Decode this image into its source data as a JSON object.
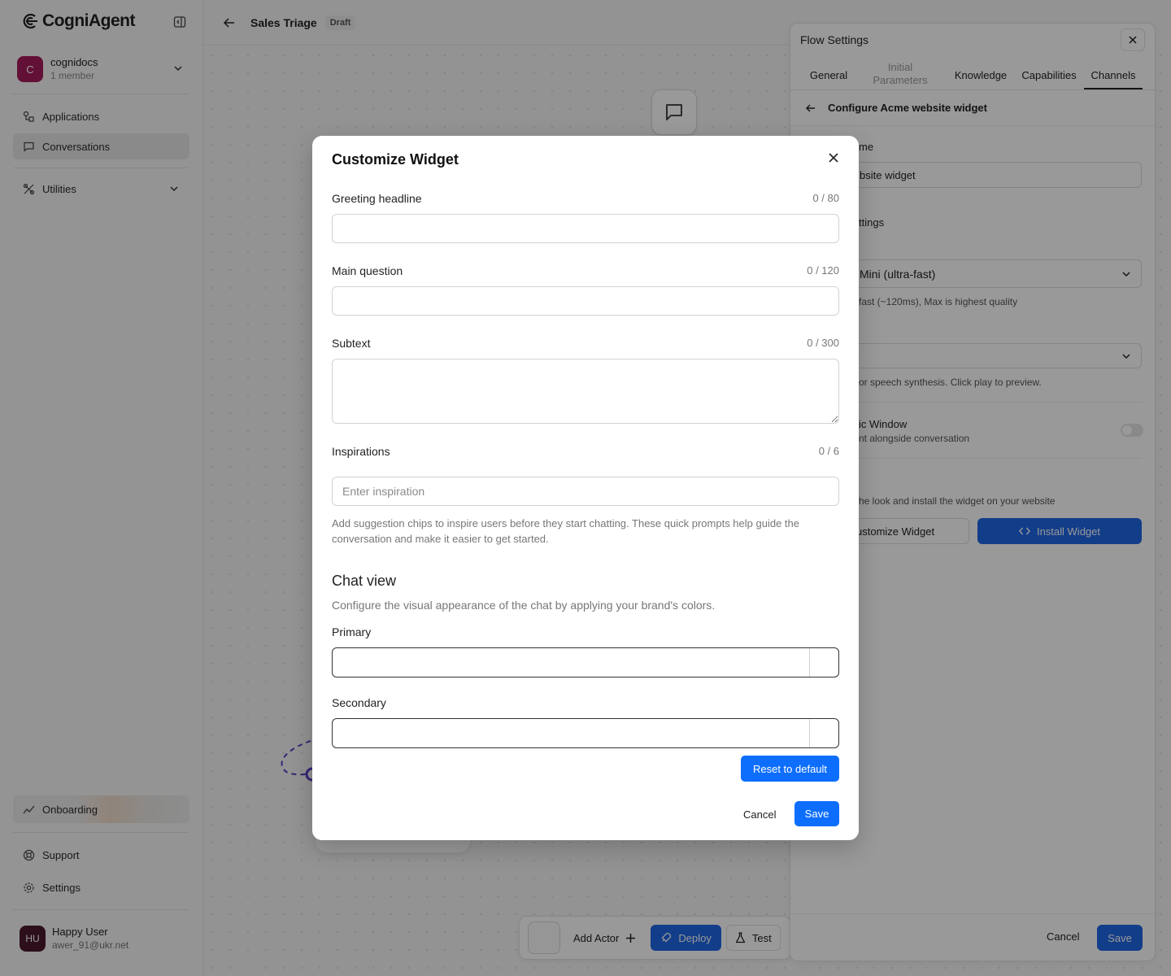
{
  "brand": {
    "name": "CogniAgent"
  },
  "workspace": {
    "initial": "C",
    "name": "cognidocs",
    "members": "1 member"
  },
  "nav": {
    "applications": "Applications",
    "conversations": "Conversations",
    "utilities": "Utilities",
    "onboarding": "Onboarding",
    "support": "Support",
    "settings": "Settings"
  },
  "user": {
    "initials": "HU",
    "name": "Happy User",
    "email": "awer_91@ukr.net"
  },
  "topbar": {
    "title": "Sales Triage",
    "status": "Draft"
  },
  "toolbar": {
    "add_actor": "Add Actor",
    "deploy": "Deploy",
    "test": "Test"
  },
  "flow_settings": {
    "title": "Flow Settings",
    "tabs": [
      "General",
      "Initial Parameters",
      "Knowledge",
      "Capabilities",
      "Channels"
    ],
    "active_tab": "Channels",
    "configure_title": "Configure Acme website widget",
    "name_label_partial": "me",
    "name_value_partial": "bsite widget",
    "settings_label_partial": "ttings",
    "model_value_partial": "Mini (ultra-fast)",
    "model_help_partial": "fast (~120ms), Max is highest quality",
    "voice_help_partial": "or speech synthesis. Click play to preview.",
    "artifact_title_partial": "ic Window",
    "artifact_help_partial": "nt alongside conversation",
    "install_help_partial": "he look and install the widget on your website",
    "customize_btn_partial": "ustomize Widget",
    "install_btn": "Install Widget",
    "cancel": "Cancel",
    "save": "Save"
  },
  "modal": {
    "title": "Customize Widget",
    "greeting": {
      "label": "Greeting headline",
      "count": "0 / 80",
      "value": ""
    },
    "main_question": {
      "label": "Main question",
      "count": "0 / 120",
      "value": ""
    },
    "subtext": {
      "label": "Subtext",
      "count": "0 / 300",
      "value": ""
    },
    "inspirations": {
      "label": "Inspirations",
      "count": "0 / 6",
      "placeholder": "Enter inspiration",
      "help": "Add suggestion chips to inspire users before they start chatting. These quick prompts help guide the conversation and make it easier to get started."
    },
    "chat_view": {
      "title": "Chat view",
      "subtitle": "Configure the visual appearance of the chat by applying your brand's colors.",
      "primary_label": "Primary",
      "secondary_label": "Secondary"
    },
    "reset": "Reset to default",
    "cancel": "Cancel",
    "save": "Save"
  },
  "colors": {
    "accent": "#0d6efd",
    "panel_accent": "#1f66e5",
    "workspace_avatar": "#a51b5a"
  }
}
